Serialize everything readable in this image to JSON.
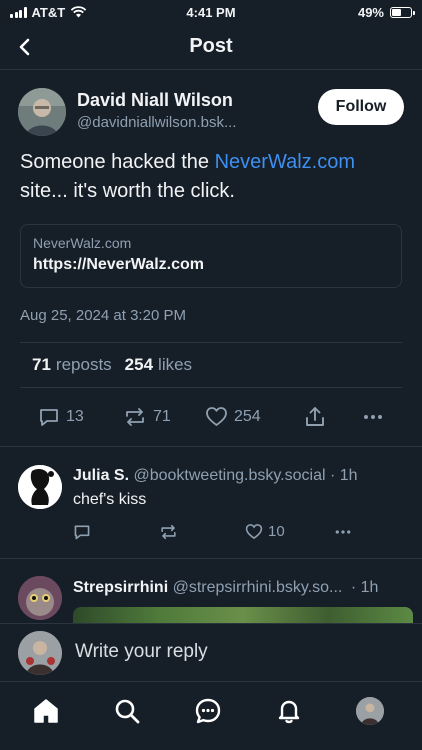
{
  "status_bar": {
    "carrier": "AT&T",
    "time": "4:41 PM",
    "battery": "49%",
    "battery_level": 0.49
  },
  "header": {
    "title": "Post"
  },
  "post": {
    "author_name": "David Niall Wilson",
    "author_handle": "@davidniallwilson.bsk...",
    "follow_label": "Follow",
    "text_before": "Someone hacked the ",
    "text_link": "NeverWalz.com",
    "text_after": " site... it's worth the click.",
    "card_domain": "NeverWalz.com",
    "card_url": "https://NeverWalz.com",
    "timestamp": "Aug 25, 2024 at 3:20 PM",
    "reposts_count": "71",
    "reposts_label": "reposts",
    "likes_count": "254",
    "likes_label": "likes",
    "action_replies": "13",
    "action_reposts": "71",
    "action_likes": "254"
  },
  "replies": [
    {
      "name": "Julia S.",
      "handle": "@booktweeting.bsky.social",
      "time": "· 1h",
      "text": "chef's kiss",
      "likes": "10"
    },
    {
      "name": "Strepsirrhini",
      "handle": "@strepsirrhini.bsky.so...",
      "time": "· 1h"
    }
  ],
  "composer": {
    "placeholder": "Write your reply"
  },
  "tabbar": {
    "tabs": [
      "home-icon",
      "search-icon",
      "chat-icon",
      "notifications-icon",
      "profile-avatar"
    ]
  },
  "colors": {
    "background": "#161e27",
    "link": "#3d8ff0",
    "muted": "#8fa0b1",
    "divider": "#2b3540"
  }
}
